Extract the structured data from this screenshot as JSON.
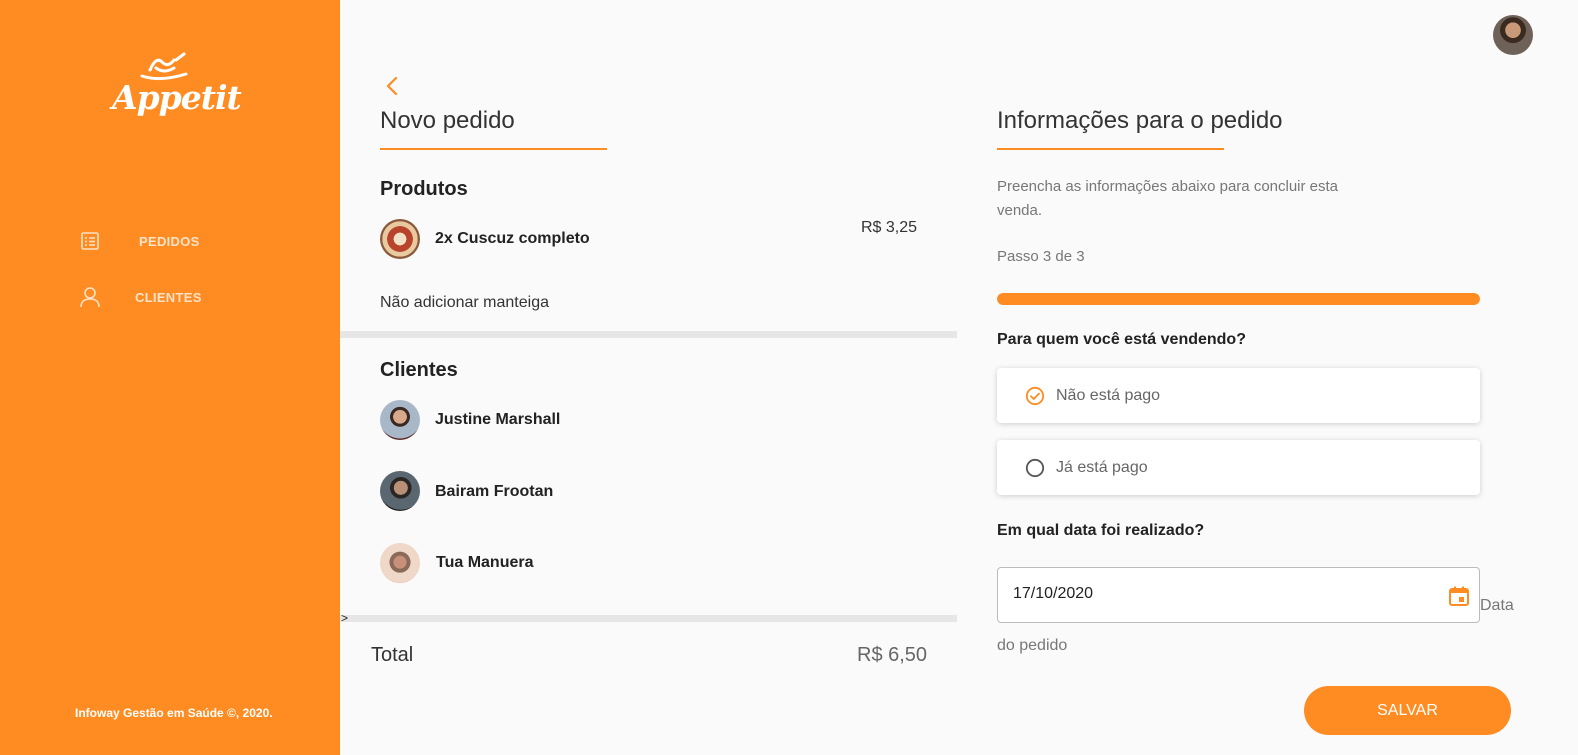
{
  "brand": {
    "name": "Appetit",
    "accent_color": "#ff8c22"
  },
  "sidebar": {
    "items": [
      {
        "label": "PEDIDOS",
        "icon": "list-icon"
      },
      {
        "label": "CLIENTES",
        "icon": "user-icon"
      }
    ],
    "footer": "Infoway Gestão em Saúde ©, 2020."
  },
  "order": {
    "title": "Novo pedido",
    "products_title": "Produtos",
    "products": [
      {
        "name": "2x Cuscuz completo",
        "price": "R$ 3,25",
        "note": "Não adicionar manteiga"
      }
    ],
    "clients_title": "Clientes",
    "clients": [
      {
        "name": "Justine Marshall"
      },
      {
        "name": "Bairam Frootan"
      },
      {
        "name": "Tua Manuera"
      }
    ],
    "caret": ">",
    "total_label": "Total",
    "total_value": "R$ 6,50"
  },
  "info": {
    "title": "Informações para o pedido",
    "description": "Preencha as informações abaixo para concluir esta venda.",
    "step": "Passo 3 de 3",
    "progress": 1.0,
    "question_payment": "Para quem você está vendendo?",
    "payment_options": [
      {
        "label": "Não está pago",
        "selected": true
      },
      {
        "label": "Já está pago",
        "selected": false
      }
    ],
    "question_date": "Em qual data foi realizado?",
    "date_value": "17/10/2020",
    "date_caption": "Data do pedido",
    "save_label": "SALVAR"
  }
}
